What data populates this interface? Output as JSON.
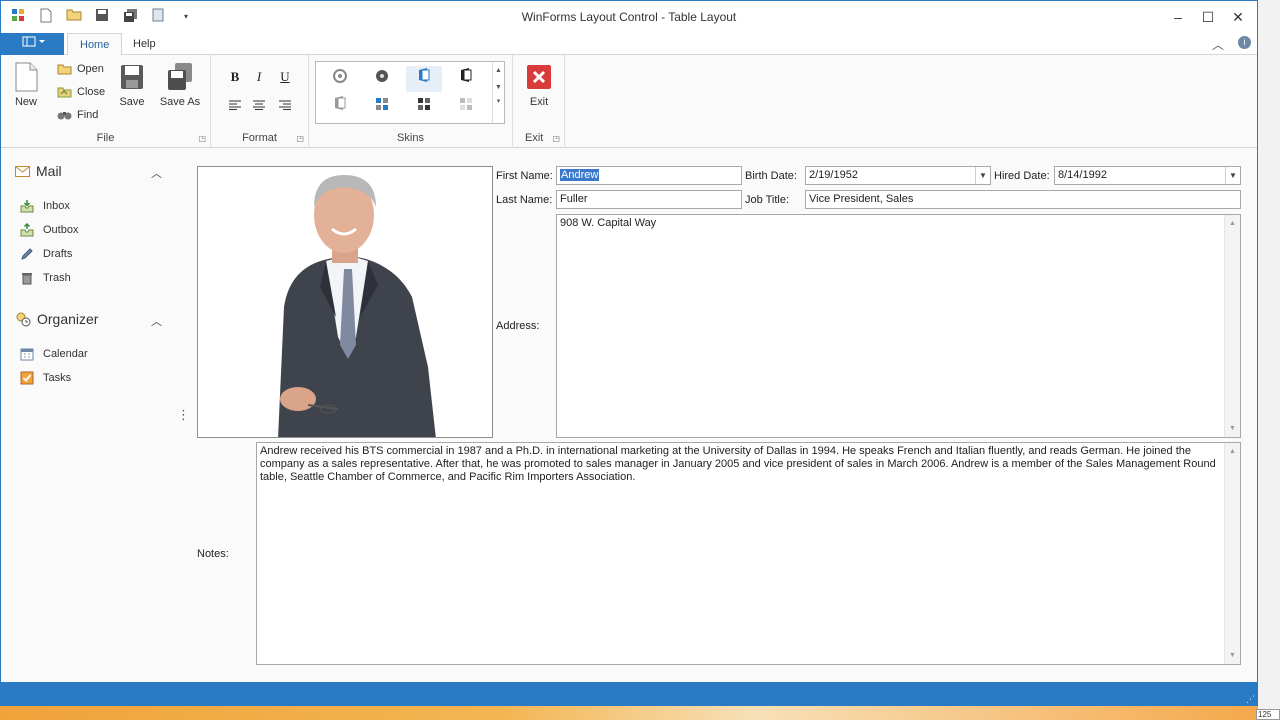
{
  "window": {
    "title": "WinForms Layout Control - Table Layout"
  },
  "qat": {
    "icons": [
      "app-icon",
      "new-icon",
      "open-icon",
      "save-icon",
      "save-all-icon",
      "document-icon",
      "customize-icon"
    ]
  },
  "tabs": {
    "home": "Home",
    "help": "Help"
  },
  "ribbon": {
    "file": {
      "label": "File",
      "new": "New",
      "open": "Open",
      "close": "Close",
      "find": "Find",
      "save": "Save",
      "save_as": "Save As"
    },
    "format": {
      "label": "Format",
      "bold": "B",
      "italic": "I",
      "underline": "U"
    },
    "skins": {
      "label": "Skins"
    },
    "exit": {
      "label": "Exit",
      "exit": "Exit"
    }
  },
  "nav": {
    "mail": {
      "title": "Mail",
      "items": [
        "Inbox",
        "Outbox",
        "Drafts",
        "Trash"
      ]
    },
    "organizer": {
      "title": "Organizer",
      "items": [
        "Calendar",
        "Tasks"
      ]
    }
  },
  "form": {
    "first_name_label": "First Name:",
    "first_name": "Andrew",
    "last_name_label": "Last Name:",
    "last_name": "Fuller",
    "birth_date_label": "Birth Date:",
    "birth_date": "2/19/1952",
    "job_title_label": "Job Title:",
    "job_title": "Vice President, Sales",
    "hired_date_label": "Hired Date:",
    "hired_date": "8/14/1992",
    "address_label": "Address:",
    "address": "908 W. Capital Way",
    "notes_label": "Notes:",
    "notes": "Andrew received his BTS commercial in 1987 and a Ph.D. in international marketing at the University of Dallas in 1994. He speaks French and Italian fluently, and reads German. He joined the company as a sales representative. After that, he was promoted to sales manager in January 2005 and vice president of sales in March 2006. Andrew is a member of the Sales Management Round table, Seattle Chamber of Commerce, and Pacific Rim Importers Association."
  },
  "desktop": {
    "badge": "125"
  },
  "colors": {
    "accent": "#2b7bc4",
    "exit_red": "#d93a3a"
  }
}
